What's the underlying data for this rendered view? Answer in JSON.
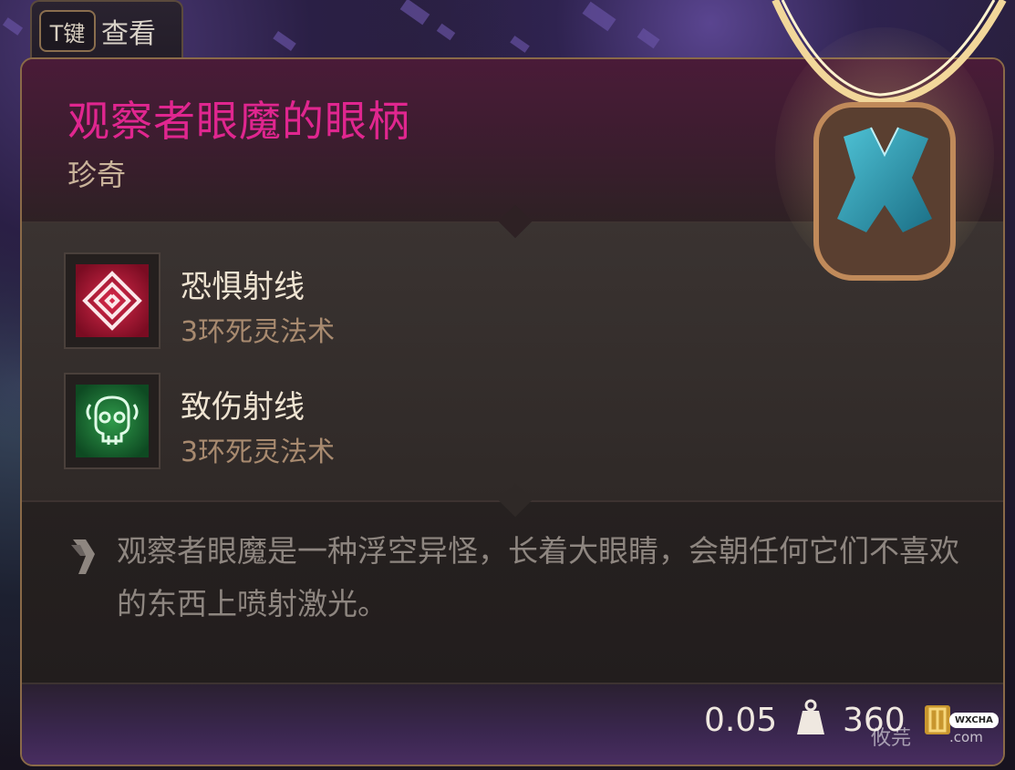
{
  "key_hint": {
    "key": "T键",
    "action": "查看"
  },
  "item": {
    "name": "观察者眼魔的眼柄",
    "rarity": "珍奇",
    "name_color": "#e0268f"
  },
  "spells": [
    {
      "name": "恐惧射线",
      "school": "3环死灵法术",
      "icon": "spiral-rune-icon",
      "icon_color": "#c2183a"
    },
    {
      "name": "致伤射线",
      "school": "3环死灵法术",
      "icon": "skull-rune-icon",
      "icon_color": "#1f7a3a"
    }
  ],
  "description": "观察者眼魔是一种浮空异怪，长着大眼睛，会朝任何它们不喜欢的东西上喷射激光。",
  "footer": {
    "weight": "0.05",
    "weight_icon": "weight-icon",
    "price": "360",
    "gold_icon": "gold-coin-icon"
  },
  "watermark": {
    "badge": "WXCHA",
    "text": "攸芫",
    "domain": ".com"
  }
}
